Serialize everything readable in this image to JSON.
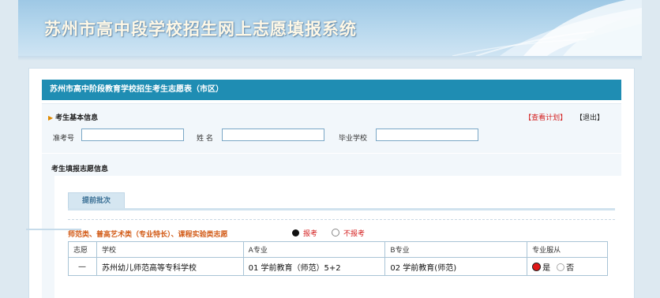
{
  "banner": {
    "title": "苏州市高中段学校招生网上志愿填报系统"
  },
  "panel": {
    "header_title": "苏州市高中阶段教育学校招生考生志愿表（市区）",
    "basic_info": {
      "title": "考生基本信息",
      "view_plan_link": "【查看计划】",
      "logout_link": "【退出】",
      "exam_no_label": "准考号",
      "exam_no_value": "",
      "name_label": "姓 名",
      "name_value": "",
      "school_label": "毕业学校",
      "school_value": ""
    },
    "fill_info": {
      "title": "考生填报志愿信息",
      "tab_label": "提前批次",
      "category_label": "师范类、普高艺术类（专业特长）、课程实验类志愿",
      "radio_apply": "报考",
      "radio_not_apply": "不报考",
      "table": {
        "headers": [
          "志愿",
          "学校",
          "A专业",
          "B专业",
          "专业服从"
        ],
        "rows": [
          {
            "index": "—",
            "school": "苏州幼儿师范高等专科学校",
            "major_a": "01 学前教育（师范）5+2",
            "major_b": "02 学前教育(师范)",
            "obey_yes": "是",
            "obey_no": "否"
          }
        ]
      }
    }
  },
  "colors": {
    "header_bar": "#1f8db3",
    "banner_text": "#fff8e6",
    "link_red": "#d42020",
    "category_orange": "#d25a16"
  }
}
